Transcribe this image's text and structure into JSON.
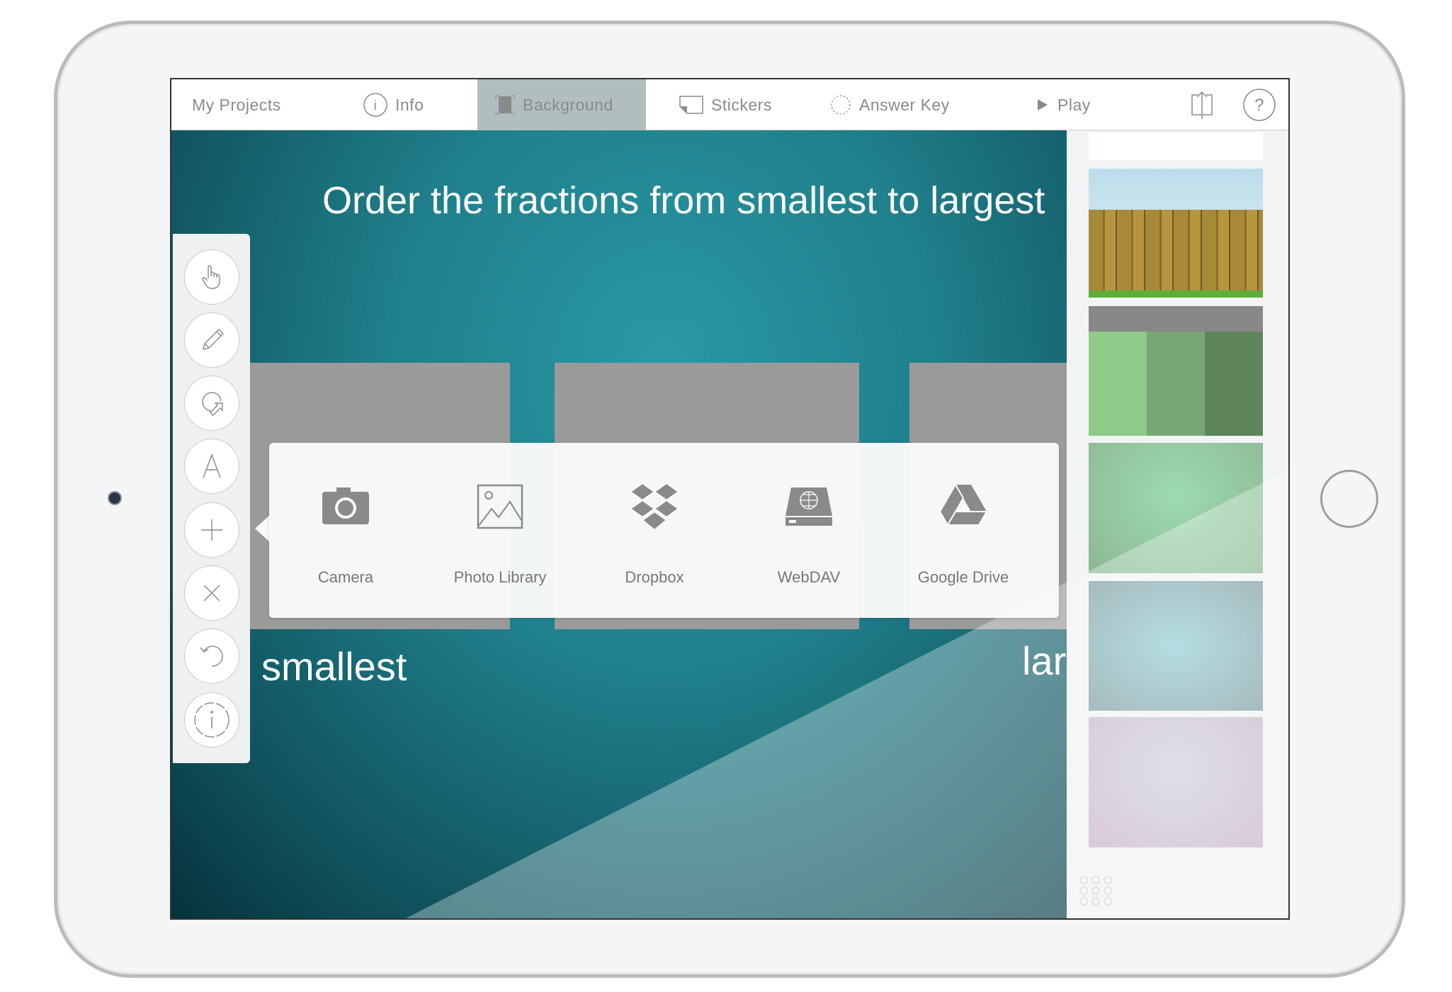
{
  "toolbar": {
    "my_projects": "My Projects",
    "info": "Info",
    "background": "Background",
    "stickers": "Stickers",
    "answer_key": "Answer Key",
    "play": "Play",
    "active_tab": "Background"
  },
  "canvas": {
    "title": "Order the fractions from smallest to largest",
    "left_label": "smallest",
    "right_label": "largest"
  },
  "tools": [
    "hand-icon",
    "pencil-icon",
    "lasso-icon",
    "text-icon",
    "add-icon",
    "close-icon",
    "undo-icon",
    "info-icon"
  ],
  "image_sources": [
    {
      "label": "Camera",
      "icon": "camera-icon"
    },
    {
      "label": "Photo Library",
      "icon": "photo-library-icon"
    },
    {
      "label": "Dropbox",
      "icon": "dropbox-icon"
    },
    {
      "label": "WebDAV",
      "icon": "webdav-icon"
    },
    {
      "label": "Google Drive",
      "icon": "google-drive-icon"
    }
  ],
  "backgrounds": [
    "white",
    "fence",
    "green-stripes",
    "mint-gradient",
    "teal-gradient",
    "lavender-gradient"
  ],
  "colors": {
    "active_tab": "#b0bec0",
    "canvas": "#2a99a6",
    "icon_gray": "#8a8a8a"
  }
}
